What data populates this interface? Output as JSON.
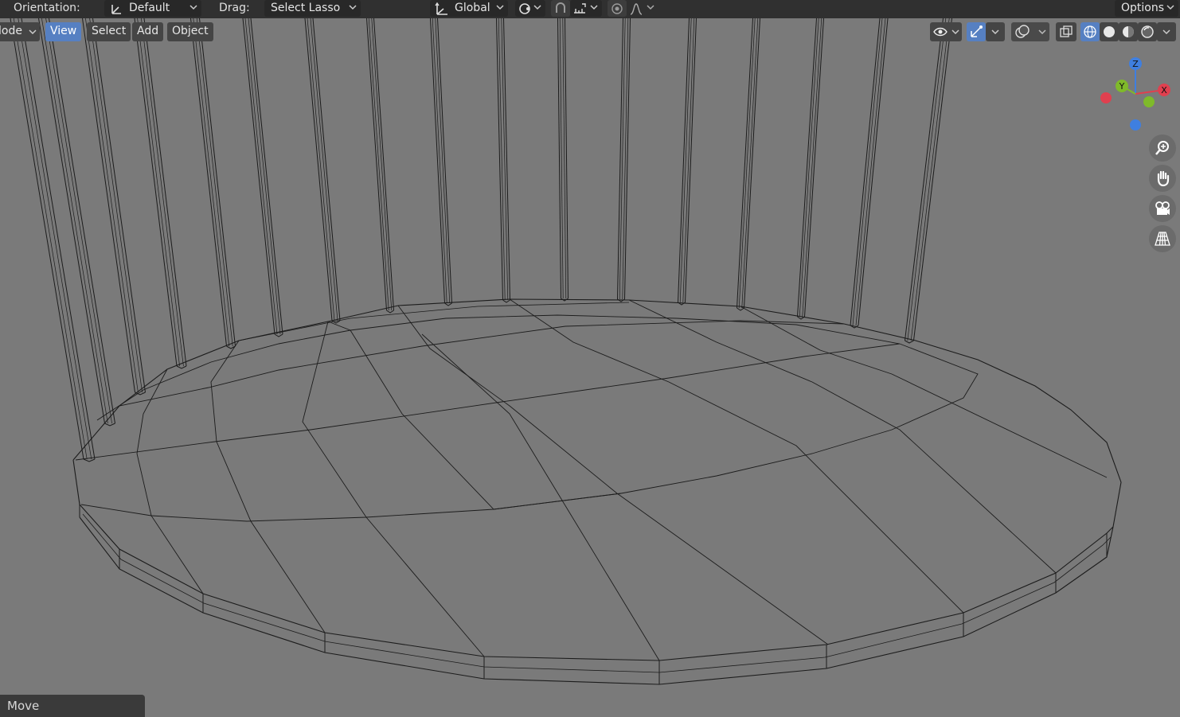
{
  "header": {
    "orientation_label": "Orientation:",
    "orientation_value": "Default",
    "drag_label": "Drag:",
    "drag_value": "Select Lasso",
    "transform_space": "Global",
    "options_label": "Options"
  },
  "viewport_header": {
    "mode_label": "lode",
    "menus": [
      "View",
      "Select",
      "Add",
      "Object"
    ]
  },
  "gizmo": {
    "z_label": "Z",
    "y_label": "Y",
    "x_label": "X"
  },
  "status": {
    "operator": "Move"
  },
  "colors": {
    "accent": "#5680c2",
    "axis_x": "#e0404f",
    "axis_y": "#7fba2a",
    "axis_z": "#3f7fe0",
    "wire": "#1a1a1a",
    "background": "#7a7a7a"
  },
  "icons": [
    "orientation-icon",
    "global-transform-icon",
    "pivot-icon",
    "snap-icon",
    "snap-increment-icon",
    "proportional-edit-icon",
    "falloff-icon",
    "visibility-icon",
    "gizmo-icon",
    "overlay-icon",
    "xray-icon",
    "wireframe-shading-icon",
    "solid-shading-icon",
    "material-shading-icon",
    "rendered-shading-icon",
    "zoom-icon",
    "hand-pan-icon",
    "camera-icon",
    "grid-icon"
  ]
}
